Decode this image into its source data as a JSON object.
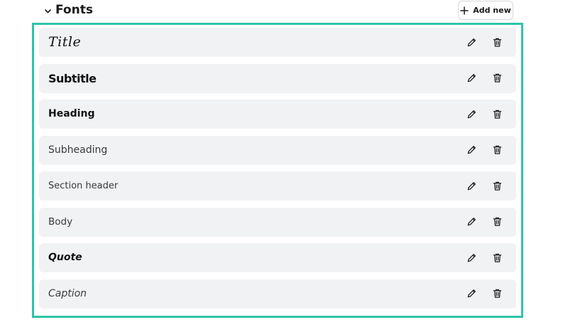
{
  "section": {
    "title": "Fonts",
    "add_label": "Add new"
  },
  "colors": {
    "accent": "#2ec4a6",
    "row_background": "#f1f2f4"
  },
  "icons": {
    "collapse": "chevron-down-icon",
    "add": "plus-icon",
    "edit": "pencil-icon",
    "delete": "trash-icon"
  },
  "fonts": [
    {
      "label": "Title"
    },
    {
      "label": "Subtitle"
    },
    {
      "label": "Heading"
    },
    {
      "label": "Subheading"
    },
    {
      "label": "Section header"
    },
    {
      "label": "Body"
    },
    {
      "label": "Quote"
    },
    {
      "label": "Caption"
    }
  ]
}
